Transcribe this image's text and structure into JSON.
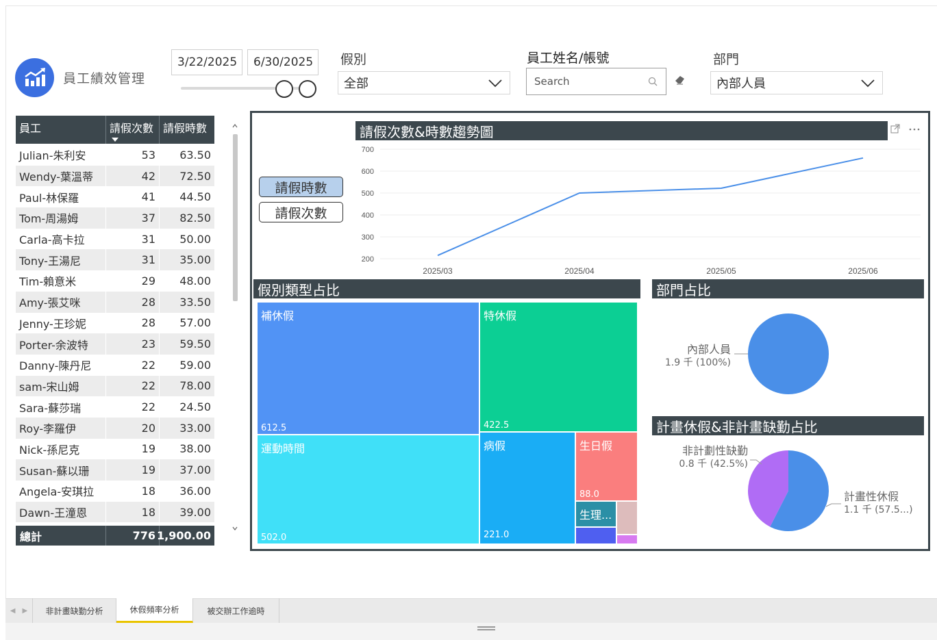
{
  "app": {
    "title": "員工績效管理"
  },
  "date_range": {
    "start": "3/22/2025",
    "end": "6/30/2025"
  },
  "filters": {
    "leave_type_label": "假別",
    "leave_type_value": "全部",
    "employee_label": "員工姓名/帳號",
    "search_placeholder": "Search",
    "dept_label": "部門",
    "dept_value": "內部人員"
  },
  "table": {
    "headers": [
      "員工",
      "請假次數",
      "請假時數"
    ],
    "rows": [
      {
        "name": "Julian-朱利安",
        "count": "53",
        "hours": "63.50"
      },
      {
        "name": "Wendy-葉溫蒂",
        "count": "42",
        "hours": "72.50"
      },
      {
        "name": "Paul-林保羅",
        "count": "41",
        "hours": "44.50"
      },
      {
        "name": "Tom-周湯姆",
        "count": "37",
        "hours": "82.50"
      },
      {
        "name": "Carla-高卡拉",
        "count": "31",
        "hours": "50.00"
      },
      {
        "name": "Tony-王湯尼",
        "count": "31",
        "hours": "35.00"
      },
      {
        "name": "Tim-賴意米",
        "count": "29",
        "hours": "48.00"
      },
      {
        "name": "Amy-張艾咪",
        "count": "28",
        "hours": "33.50"
      },
      {
        "name": "Jenny-王珍妮",
        "count": "28",
        "hours": "57.00"
      },
      {
        "name": "Porter-余波特",
        "count": "23",
        "hours": "59.50"
      },
      {
        "name": "Danny-陳丹尼",
        "count": "22",
        "hours": "59.00"
      },
      {
        "name": "sam-宋山姆",
        "count": "22",
        "hours": "78.00"
      },
      {
        "name": "Sara-蘇莎瑞",
        "count": "22",
        "hours": "24.50"
      },
      {
        "name": "Roy-李羅伊",
        "count": "20",
        "hours": "33.00"
      },
      {
        "name": "Nick-孫尼克",
        "count": "19",
        "hours": "38.00"
      },
      {
        "name": "Susan-蘇以珊",
        "count": "19",
        "hours": "37.00"
      },
      {
        "name": "Angela-安琪拉",
        "count": "18",
        "hours": "36.00"
      },
      {
        "name": "Dawn-王潼恩",
        "count": "18",
        "hours": "39.00"
      }
    ],
    "total": {
      "label": "總計",
      "count": "776",
      "hours": "1,900.00"
    }
  },
  "toggles": {
    "hours": "請假時數",
    "count": "請假次數"
  },
  "sections": {
    "trend": "請假次數&時數趨勢圖",
    "types": "假別類型占比",
    "dept": "部門占比",
    "planned": "計畫休假&非計畫缺勤占比"
  },
  "chart_data": [
    {
      "type": "line",
      "title": "請假次數&時數趨勢圖",
      "x": [
        "2025/03",
        "2025/04",
        "2025/05",
        "2025/06"
      ],
      "series": [
        {
          "values": [
            215,
            500,
            522,
            660
          ]
        }
      ],
      "yticks": [
        "700",
        "600",
        "500",
        "400",
        "300",
        "200"
      ],
      "ylim": [
        200,
        700
      ],
      "color": "#4a8fe8",
      "grid": true
    },
    {
      "type": "treemap",
      "title": "假別類型占比",
      "items": [
        {
          "label": "補休假",
          "value": "612.5",
          "color": "#5193f5"
        },
        {
          "label": "特休假",
          "value": "422.5",
          "color": "#0ccf94"
        },
        {
          "label": "運動時間",
          "value": "502.0",
          "color": "#40e0f8"
        },
        {
          "label": "病假",
          "value": "221.0",
          "color": "#1aadf5"
        },
        {
          "label": "生日假",
          "value": "88.0",
          "color": "#fa7e7e"
        },
        {
          "label": "生理...",
          "value": "",
          "color": "#2b8fa6"
        }
      ]
    },
    {
      "type": "pie",
      "title": "部門占比",
      "slices": [
        {
          "label": "內部人員",
          "value": "1.9 千 (100%)",
          "fraction": 1.0,
          "color": "#4a8fe8"
        }
      ]
    },
    {
      "type": "pie",
      "title": "計畫休假&非計畫缺勤占比",
      "slices": [
        {
          "label": "計畫性休假",
          "value": "1.1 千 (57.5...)",
          "fraction": 0.575,
          "color": "#4a8fe8"
        },
        {
          "label": "非計劃性缺勤",
          "value": "0.8 千 (42.5%)",
          "fraction": 0.425,
          "color": "#b06cf5"
        }
      ]
    }
  ],
  "tabs": [
    {
      "label": "非計畫缺勤分析"
    },
    {
      "label": "休假頻率分析"
    },
    {
      "label": "被交辦工作逾時"
    }
  ]
}
